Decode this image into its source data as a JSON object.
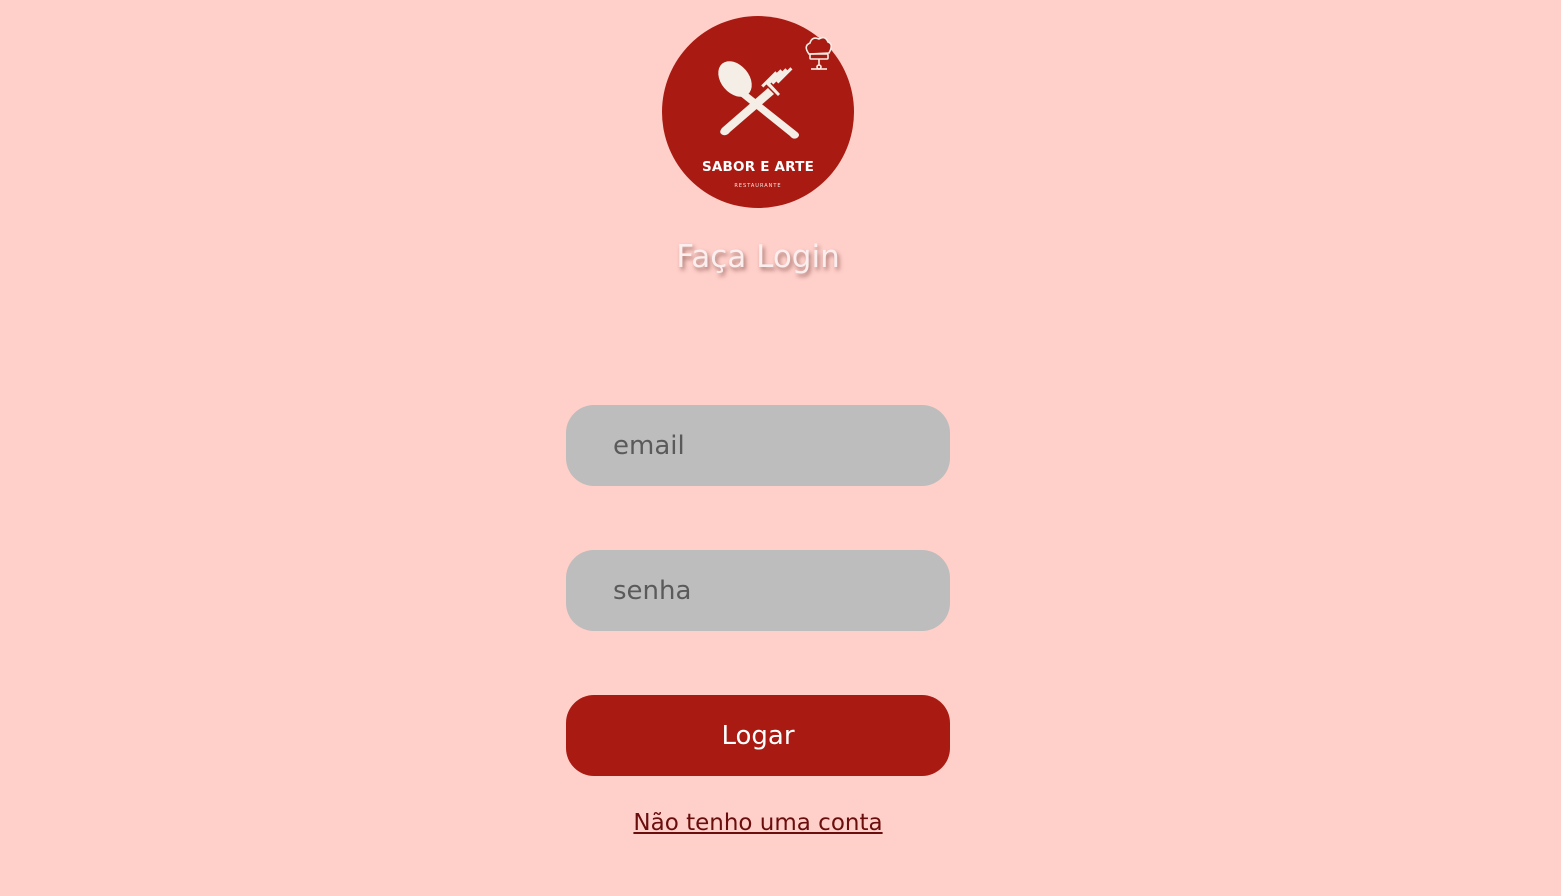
{
  "logo": {
    "name": "SABOR E ARTE",
    "subtitle": "RESTAURANTE",
    "icon": "spoon-fork-crossed-icon",
    "badge_icon": "chef-hat-icon"
  },
  "title": "Faça Login",
  "form": {
    "email_placeholder": "email",
    "password_placeholder": "senha",
    "submit_label": "Logar"
  },
  "signup_link": "Não tenho uma conta",
  "colors": {
    "background": "#ffcfc9",
    "brand": "#a91b12",
    "input": "#bdbdbd",
    "link": "#6a0d0d"
  }
}
